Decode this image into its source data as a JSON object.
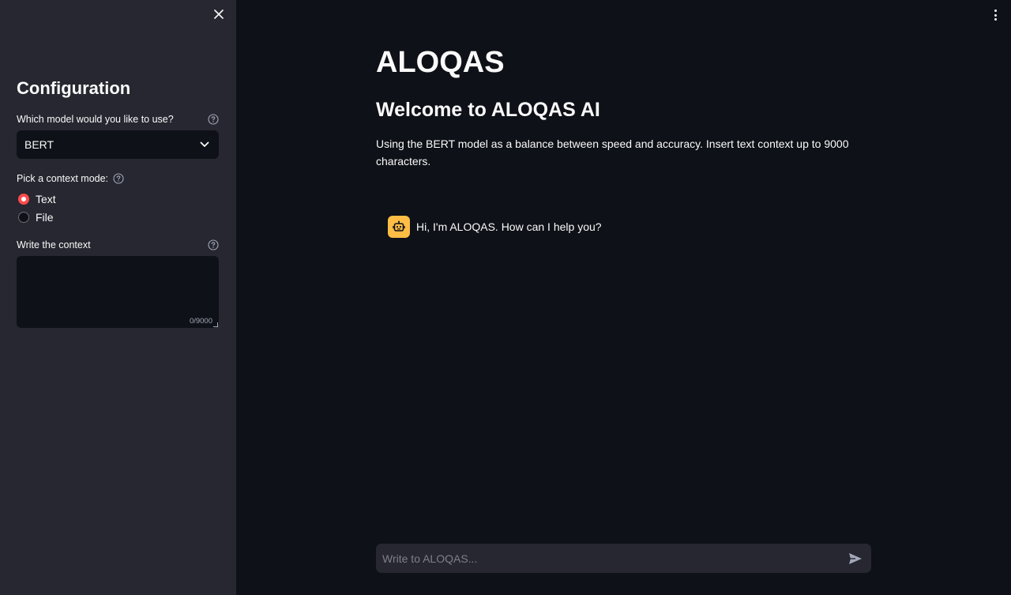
{
  "sidebar": {
    "title": "Configuration",
    "model_label": "Which model would you like to use?",
    "model_selected": "BERT",
    "mode_label": "Pick a context mode:",
    "modes": [
      {
        "label": "Text",
        "checked": true
      },
      {
        "label": "File",
        "checked": false
      }
    ],
    "context_label": "Write the context",
    "context_value": "",
    "char_count": "0/9000"
  },
  "main": {
    "title": "ALOQAS",
    "subtitle": "Welcome to ALOQAS AI",
    "description": "Using the BERT model as a balance between speed and accuracy. Insert text context up to 9000 characters.",
    "messages": [
      {
        "role": "assistant",
        "avatar_icon": "robot-icon",
        "text": "Hi, I'm ALOQAS. How can I help you?"
      }
    ],
    "chat_input": {
      "placeholder": "Write to ALOQAS...",
      "value": ""
    }
  },
  "icons": {
    "close": "close-icon",
    "menu": "vertical-dots-icon",
    "help": "help-circle-icon",
    "dropdown": "chevron-down-icon",
    "send": "send-icon",
    "avatar": "robot-icon"
  },
  "colors": {
    "background": "#0e1117",
    "sidebar": "#262730",
    "accent": "#ff4b4b",
    "avatar": "#ffbd45"
  }
}
